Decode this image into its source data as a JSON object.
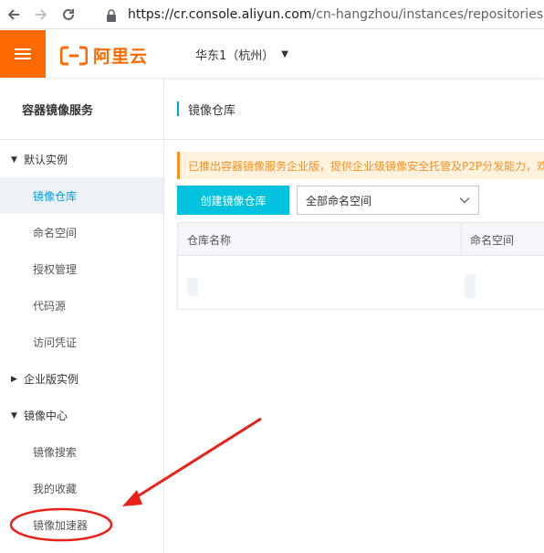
{
  "browser": {
    "url_host": "https://cr.console.aliyun.com",
    "url_path": "/cn-hangzhou/instances/repositories"
  },
  "header": {
    "logo_text": "阿里云",
    "region": "华东1（杭州）"
  },
  "sidebar": {
    "title": "容器镜像服务",
    "groups": [
      {
        "label": "默认实例",
        "expanded": true
      },
      {
        "label": "企业版实例",
        "expanded": false
      },
      {
        "label": "镜像中心",
        "expanded": true
      }
    ],
    "items": [
      {
        "label": "镜像仓库",
        "active": true
      },
      {
        "label": "命名空间"
      },
      {
        "label": "授权管理"
      },
      {
        "label": "代码源"
      },
      {
        "label": "访问凭证"
      },
      {
        "label": "镜像搜索"
      },
      {
        "label": "我的收藏"
      },
      {
        "label": "镜像加速器"
      }
    ]
  },
  "main": {
    "title": "镜像仓库",
    "notice": "已推出容器镜像服务企业版，提供企业级镜像安全托管及P2P分发能力，欢",
    "create_button": "创建镜像仓库",
    "namespace_select": "全部命名空间",
    "table": {
      "columns": [
        "仓库名称",
        "命名空间"
      ]
    }
  },
  "colors": {
    "brand": "#ff6a00",
    "accent": "#00c1de",
    "link": "#00a0e9",
    "annotation": "#e8221a"
  }
}
